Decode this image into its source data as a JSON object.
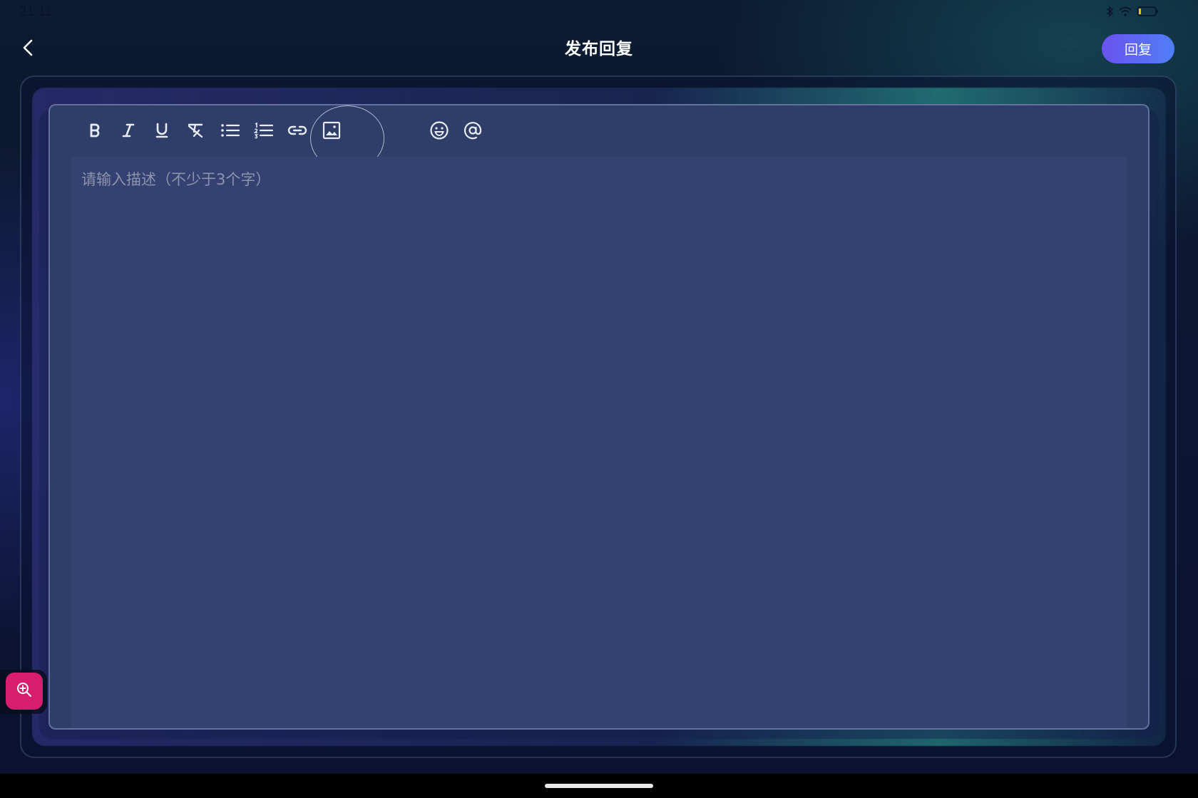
{
  "status_bar": {
    "time": "21:11"
  },
  "header": {
    "back_icon": "chevron-left-icon",
    "title": "发布回复",
    "reply_label": "回复"
  },
  "toolbar": {
    "tools": [
      {
        "name": "bold",
        "icon": "bold-icon"
      },
      {
        "name": "italic",
        "icon": "italic-icon"
      },
      {
        "name": "underline",
        "icon": "underline-icon"
      },
      {
        "name": "clear-format",
        "icon": "clear-format-icon"
      },
      {
        "name": "bullet-list",
        "icon": "bullet-list-icon"
      },
      {
        "name": "numbered-list",
        "icon": "numbered-list-icon"
      },
      {
        "name": "link",
        "icon": "link-icon"
      },
      {
        "name": "image",
        "icon": "image-icon"
      },
      {
        "name": "emoji",
        "icon": "smiley-icon"
      },
      {
        "name": "mention",
        "icon": "at-sign-icon"
      }
    ]
  },
  "editor": {
    "placeholder": "请输入描述（不少于3个字）"
  },
  "floating": {
    "zoom_icon": "zoom-in-icon"
  },
  "colors": {
    "reply_button_start": "#6a52f0",
    "reply_button_end": "#4f7ef7",
    "zoom_button": "#d81d6e",
    "editor_bg": "#334270"
  }
}
